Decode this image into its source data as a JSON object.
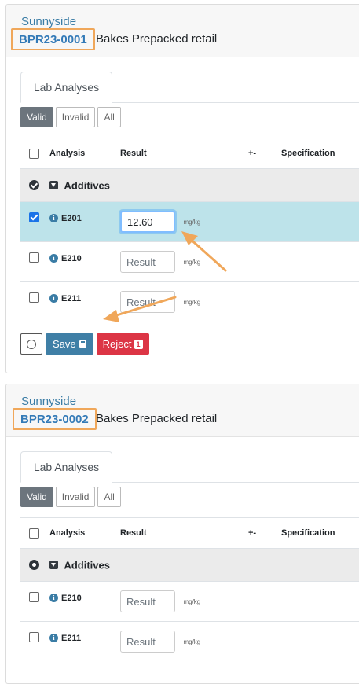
{
  "samples": [
    {
      "client": "Sunnyside",
      "sample_id": "BPR23-0001",
      "sample_type": "Bakes Prepacked retail",
      "tab_label": "Lab Analyses",
      "filters": [
        "Valid",
        "Invalid",
        "All"
      ],
      "columns": [
        "Analysis",
        "Result",
        "+-",
        "Specification"
      ],
      "category": "Additives",
      "rows": [
        {
          "name": "E201",
          "value": "12.60",
          "placeholder": "Result",
          "unit": "mg/kg",
          "checked": true
        },
        {
          "name": "E210",
          "value": "",
          "placeholder": "Result",
          "unit": "mg/kg",
          "checked": false
        },
        {
          "name": "E211",
          "value": "",
          "placeholder": "Result",
          "unit": "mg/kg",
          "checked": false
        }
      ],
      "save_label": "Save",
      "reject_label": "Reject",
      "reject_count": "1"
    },
    {
      "client": "Sunnyside",
      "sample_id": "BPR23-0002",
      "sample_type": "Bakes Prepacked retail",
      "tab_label": "Lab Analyses",
      "filters": [
        "Valid",
        "Invalid",
        "All"
      ],
      "columns": [
        "Analysis",
        "Result",
        "+-",
        "Specification"
      ],
      "category": "Additives",
      "rows": [
        {
          "name": "E210",
          "value": "",
          "placeholder": "Result",
          "unit": "mg/kg",
          "checked": false
        },
        {
          "name": "E211",
          "value": "",
          "placeholder": "Result",
          "unit": "mg/kg",
          "checked": false
        }
      ]
    }
  ],
  "colors": {
    "highlight_border": "#f0a75a",
    "link": "#337ab7",
    "selected_row": "#bde3ea",
    "save": "#3f7fa6",
    "reject": "#dc3545",
    "active_filter": "#6c757d"
  },
  "icons": {
    "info": "info-circle-icon",
    "category_toggle": "caret-down-icon",
    "save": "floppy-disk-icon",
    "refresh": "circle-icon"
  }
}
